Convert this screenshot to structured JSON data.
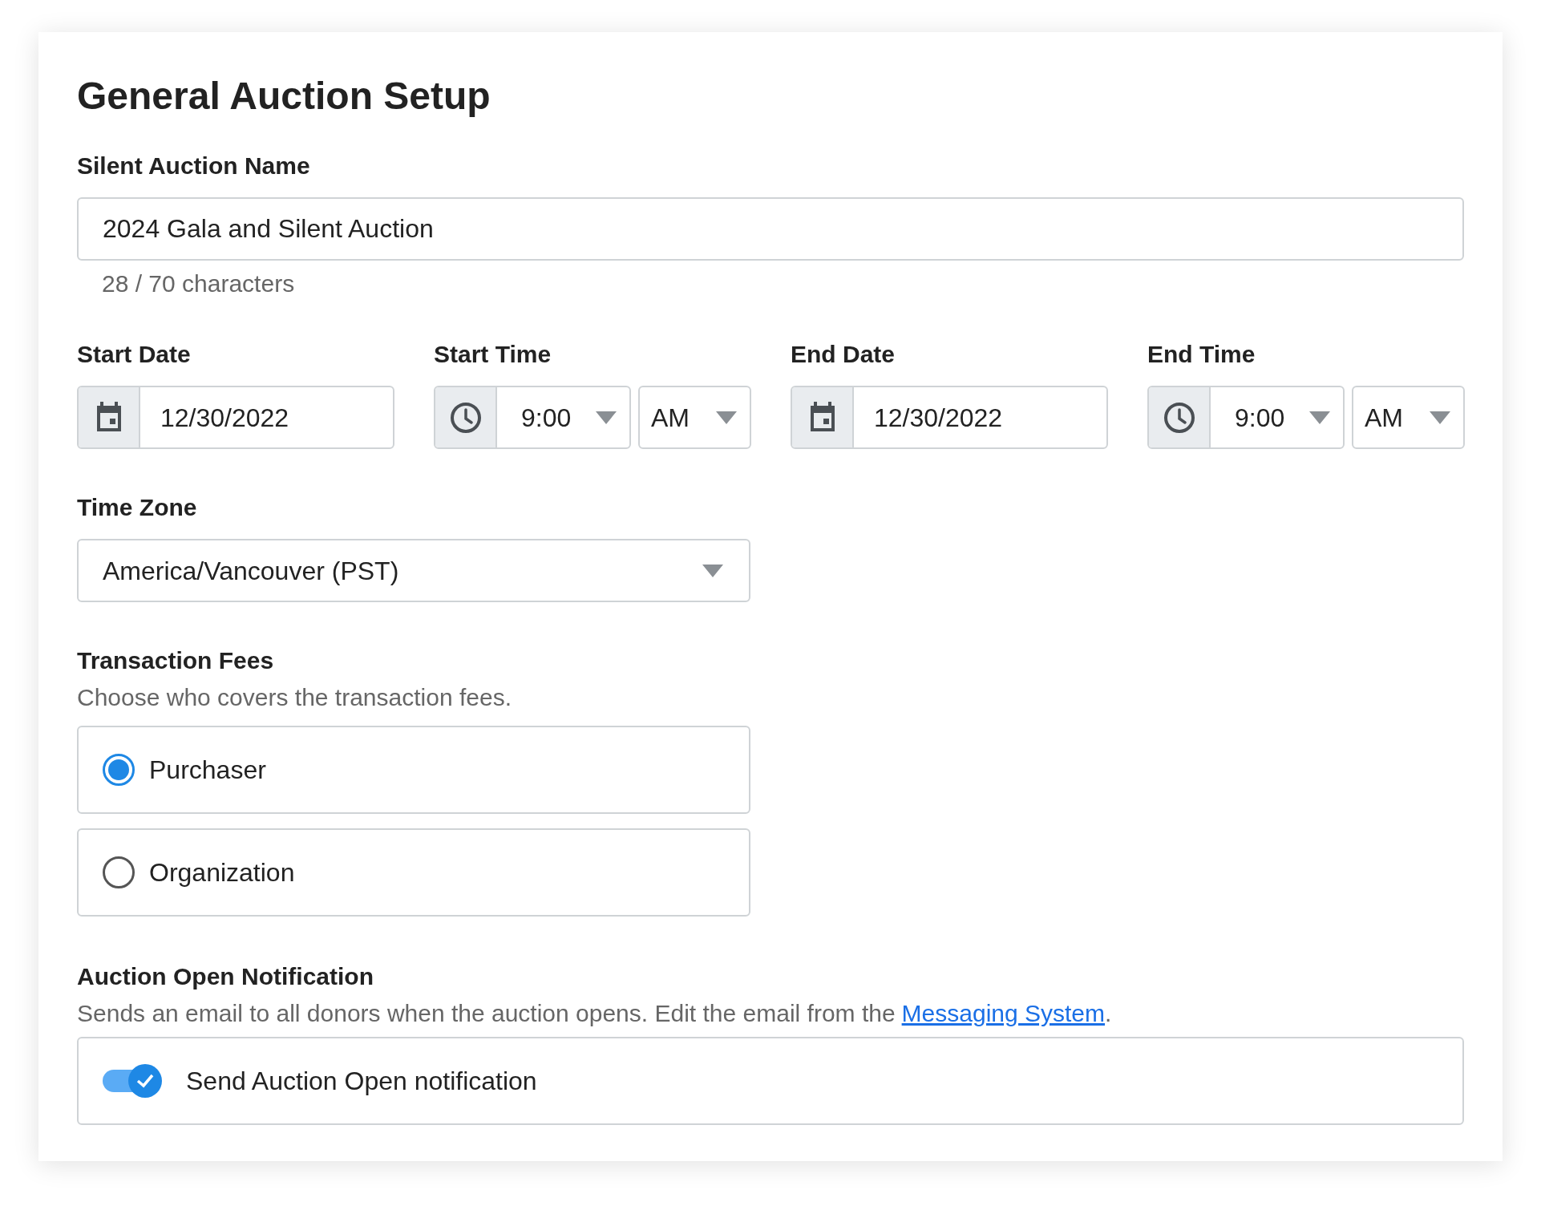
{
  "title": "General Auction Setup",
  "name_field": {
    "label": "Silent Auction Name",
    "value": "2024 Gala and Silent Auction",
    "counter": "28 / 70 characters"
  },
  "schedule": [
    {
      "kind": "date",
      "label": "Start Date",
      "value": "12/30/2022"
    },
    {
      "kind": "time",
      "label": "Start Time",
      "value": "9:00",
      "period": "AM"
    },
    {
      "kind": "date",
      "label": "End Date",
      "value": "12/30/2022"
    },
    {
      "kind": "time",
      "label": "End Time",
      "value": "9:00",
      "period": "AM"
    }
  ],
  "time_zone": {
    "label": "Time Zone",
    "value": "America/Vancouver (PST)"
  },
  "transaction_fees": {
    "label": "Transaction Fees",
    "description": "Choose who covers the transaction fees.",
    "options": [
      {
        "label": "Purchaser",
        "selected": true
      },
      {
        "label": "Organization",
        "selected": false
      }
    ]
  },
  "notification": {
    "label": "Auction Open Notification",
    "description": "Sends an email to all donors when the auction opens. Edit the email from the",
    "link": "Messaging System",
    "after_link": ".",
    "toggle": {
      "label": "Send Auction Open notification",
      "on": true
    }
  }
}
